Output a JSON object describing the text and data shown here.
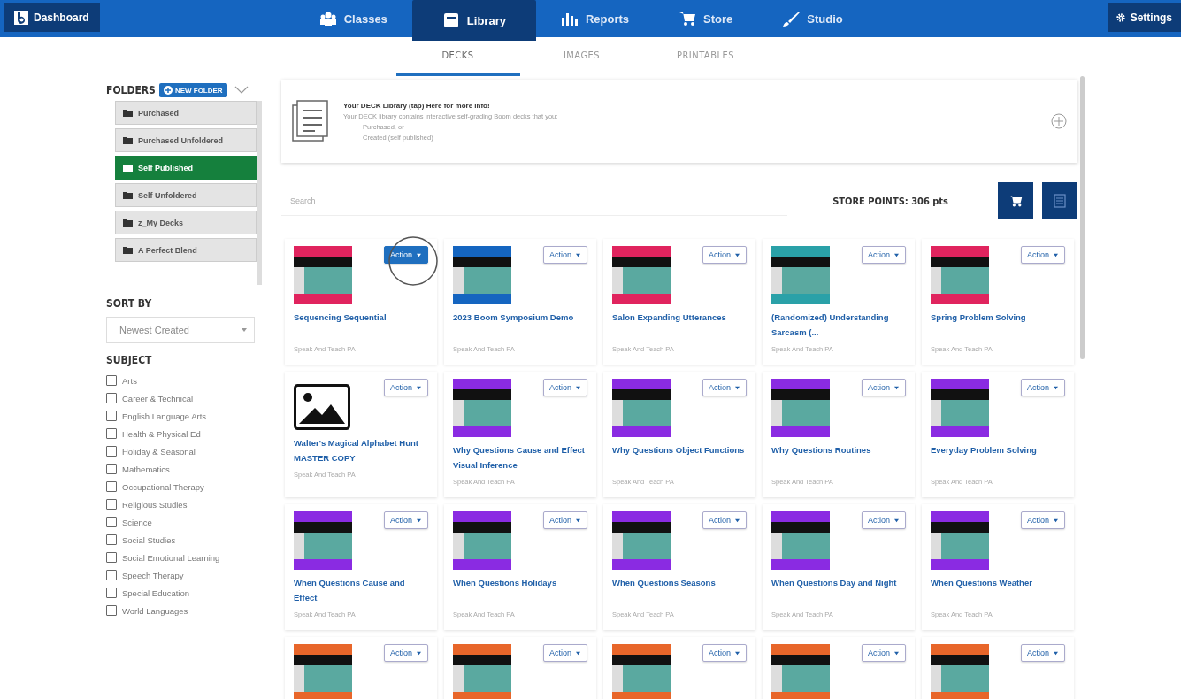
{
  "nav": {
    "home": "Dashboard",
    "items": [
      {
        "label": "Classes",
        "selected": false
      },
      {
        "label": "Library",
        "selected": true
      },
      {
        "label": "Reports",
        "selected": false
      },
      {
        "label": "Store",
        "selected": false
      },
      {
        "label": "Studio",
        "selected": false
      }
    ],
    "settings": "Settings"
  },
  "subtabs": [
    {
      "label": "DECKS",
      "selected": true
    },
    {
      "label": "IMAGES",
      "selected": false
    },
    {
      "label": "PRINTABLES",
      "selected": false
    }
  ],
  "sidebar": {
    "folders_title": "FOLDERS",
    "new_folder": "NEW FOLDER",
    "folders": [
      {
        "label": "Purchased",
        "selected": false
      },
      {
        "label": "Purchased Unfoldered",
        "selected": false
      },
      {
        "label": "Self Published",
        "selected": true
      },
      {
        "label": "Self Unfoldered",
        "selected": false
      },
      {
        "label": "z_My Decks",
        "selected": false
      },
      {
        "label": "A Perfect Blend",
        "selected": false
      }
    ],
    "sort_title": "SORT BY",
    "sort_value": "Newest Created",
    "subject_title": "SUBJECT",
    "subjects": [
      {
        "label": "Arts",
        "checked": false
      },
      {
        "label": "Career & Technical",
        "checked": false
      },
      {
        "label": "English Language Arts",
        "checked": false
      },
      {
        "label": "Health & Physical Ed",
        "checked": false
      },
      {
        "label": "Holiday & Seasonal",
        "checked": false
      },
      {
        "label": "Mathematics",
        "checked": false
      },
      {
        "label": "Occupational Therapy",
        "checked": false
      },
      {
        "label": "Religious Studies",
        "checked": false
      },
      {
        "label": "Science",
        "checked": false
      },
      {
        "label": "Social Studies",
        "checked": false
      },
      {
        "label": "Social Emotional Learning",
        "checked": false
      },
      {
        "label": "Speech Therapy",
        "checked": false
      },
      {
        "label": "Special Education",
        "checked": false
      },
      {
        "label": "World Languages",
        "checked": false
      }
    ]
  },
  "banner": {
    "title": "Your DECK Library (tap) Here for more info!",
    "text": "Your DECK library contains interactive self-grading Boom decks that you:",
    "points": [
      "Purchased, or",
      "Created (self published)"
    ]
  },
  "search": {
    "placeholder": "Search"
  },
  "store_points": "STORE POINTS: 306 pts",
  "cards": [
    {
      "kind": "cover",
      "color": "#e0245e",
      "title": "Sequencing Sequential",
      "author": "Speak And Teach PA",
      "action": "Action",
      "highlighted": true
    },
    {
      "kind": "cover",
      "color": "#1565c0",
      "title": "2023 Boom Symposium Demo",
      "author": "Speak And Teach PA",
      "action": "Action",
      "highlighted": false
    },
    {
      "kind": "cover",
      "color": "#e0245e",
      "title": "Salon Expanding Utterances",
      "author": "Speak And Teach PA",
      "action": "Action",
      "highlighted": false
    },
    {
      "kind": "cover",
      "color": "#2aa1a8",
      "title": "(Randomized) Understanding Sarcasm (...",
      "author": "Speak And Teach PA",
      "action": "Action",
      "highlighted": false
    },
    {
      "kind": "cover",
      "color": "#e0245e",
      "title": "Spring Problem Solving",
      "author": "Speak And Teach PA",
      "action": "Action",
      "highlighted": false
    },
    {
      "kind": "placeholder",
      "title": "Walter's Magical Alphabet Hunt MASTER COPY",
      "author": "Speak And Teach PA",
      "action": "Action",
      "highlighted": false
    },
    {
      "kind": "cover",
      "color": "#8a2be2",
      "title": "Why Questions Cause and Effect Visual Inference",
      "author": "Speak And Teach PA",
      "action": "Action",
      "highlighted": false
    },
    {
      "kind": "cover",
      "color": "#8a2be2",
      "title": "Why Questions Object Functions",
      "author": "Speak And Teach PA",
      "action": "Action",
      "highlighted": false
    },
    {
      "kind": "cover",
      "color": "#8a2be2",
      "title": "Why Questions Routines",
      "author": "Speak And Teach PA",
      "action": "Action",
      "highlighted": false
    },
    {
      "kind": "cover",
      "color": "#8a2be2",
      "title": "Everyday Problem Solving",
      "author": "Speak And Teach PA",
      "action": "Action",
      "highlighted": false
    },
    {
      "kind": "cover",
      "color": "#8a2be2",
      "title": "When Questions Cause and Effect",
      "author": "Speak And Teach PA",
      "action": "Action",
      "highlighted": false
    },
    {
      "kind": "cover",
      "color": "#8a2be2",
      "title": "When Questions Holidays",
      "author": "Speak And Teach PA",
      "action": "Action",
      "highlighted": false
    },
    {
      "kind": "cover",
      "color": "#8a2be2",
      "title": "When Questions Seasons",
      "author": "Speak And Teach PA",
      "action": "Action",
      "highlighted": false
    },
    {
      "kind": "cover",
      "color": "#8a2be2",
      "title": "When Questions Day and Night",
      "author": "Speak And Teach PA",
      "action": "Action",
      "highlighted": false
    },
    {
      "kind": "cover",
      "color": "#8a2be2",
      "title": "When Questions Weather",
      "author": "Speak And Teach PA",
      "action": "Action",
      "highlighted": false
    },
    {
      "kind": "cover",
      "color": "#e8662a",
      "action": "Action",
      "highlighted": false
    },
    {
      "kind": "cover",
      "color": "#e8662a",
      "action": "Action",
      "highlighted": false
    },
    {
      "kind": "cover",
      "color": "#e8662a",
      "action": "Action",
      "highlighted": false
    },
    {
      "kind": "cover",
      "color": "#e8662a",
      "action": "Action",
      "highlighted": false
    },
    {
      "kind": "cover",
      "color": "#e8662a",
      "action": "Action",
      "highlighted": false
    }
  ]
}
